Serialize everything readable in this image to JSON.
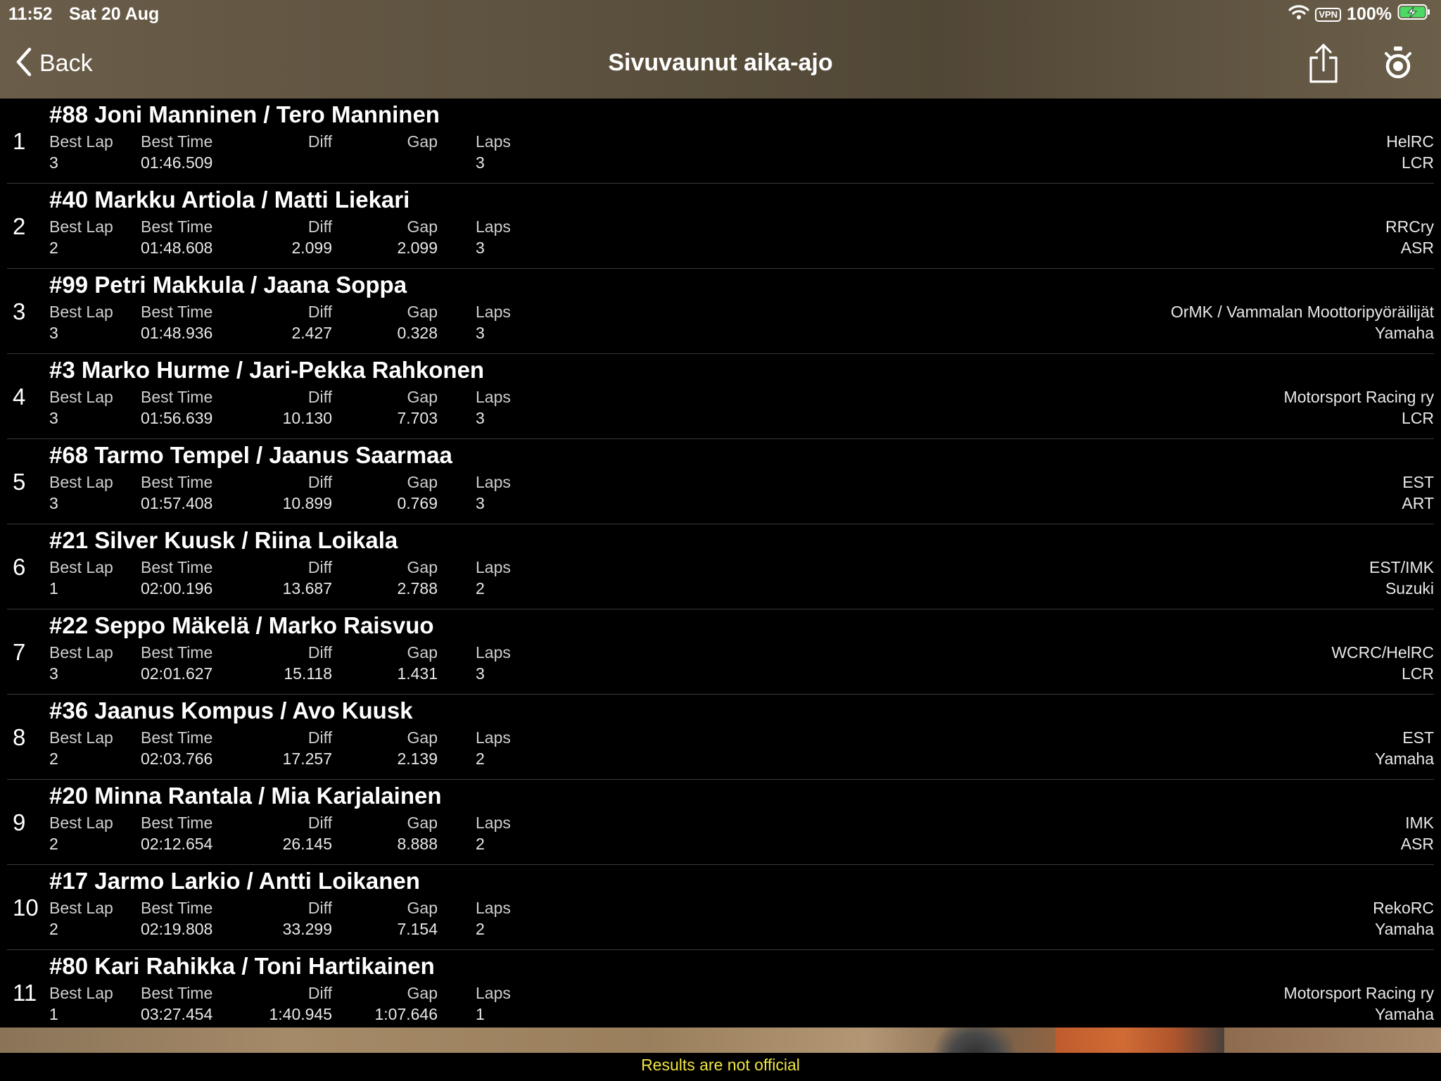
{
  "status_bar": {
    "time": "11:52",
    "date": "Sat 20 Aug",
    "vpn_label": "VPN",
    "battery": "100%"
  },
  "nav": {
    "back_label": "Back",
    "title": "Sivuvaunut aika-ajo"
  },
  "columns": {
    "best_lap": "Best Lap",
    "best_time": "Best Time",
    "diff": "Diff",
    "gap": "Gap",
    "laps": "Laps"
  },
  "results": [
    {
      "pos": "1",
      "driver": "#88 Joni Manninen / Tero Manninen",
      "best_lap": "3",
      "best_time": "01:46.509",
      "diff": "",
      "gap": "",
      "laps": "3",
      "club": "HelRC",
      "make": "LCR"
    },
    {
      "pos": "2",
      "driver": "#40 Markku Artiola / Matti Liekari",
      "best_lap": "2",
      "best_time": "01:48.608",
      "diff": "2.099",
      "gap": "2.099",
      "laps": "3",
      "club": "RRCry",
      "make": "ASR"
    },
    {
      "pos": "3",
      "driver": "#99 Petri Makkula / Jaana Soppa",
      "best_lap": "3",
      "best_time": "01:48.936",
      "diff": "2.427",
      "gap": "0.328",
      "laps": "3",
      "club": "OrMK / Vammalan Moottoripyöräilijät",
      "make": "Yamaha"
    },
    {
      "pos": "4",
      "driver": "#3 Marko Hurme / Jari-Pekka Rahkonen",
      "best_lap": "3",
      "best_time": "01:56.639",
      "diff": "10.130",
      "gap": "7.703",
      "laps": "3",
      "club": "Motorsport Racing ry",
      "make": "LCR"
    },
    {
      "pos": "5",
      "driver": "#68 Tarmo Tempel / Jaanus Saarmaa",
      "best_lap": "3",
      "best_time": "01:57.408",
      "diff": "10.899",
      "gap": "0.769",
      "laps": "3",
      "club": "EST",
      "make": "ART"
    },
    {
      "pos": "6",
      "driver": "#21 Silver Kuusk / Riina Loikala",
      "best_lap": "1",
      "best_time": "02:00.196",
      "diff": "13.687",
      "gap": "2.788",
      "laps": "2",
      "club": "EST/IMK",
      "make": "Suzuki"
    },
    {
      "pos": "7",
      "driver": "#22 Seppo Mäkelä / Marko Raisvuo",
      "best_lap": "3",
      "best_time": "02:01.627",
      "diff": "15.118",
      "gap": "1.431",
      "laps": "3",
      "club": "WCRC/HelRC",
      "make": "LCR"
    },
    {
      "pos": "8",
      "driver": "#36 Jaanus Kompus / Avo Kuusk",
      "best_lap": "2",
      "best_time": "02:03.766",
      "diff": "17.257",
      "gap": "2.139",
      "laps": "2",
      "club": "EST",
      "make": "Yamaha"
    },
    {
      "pos": "9",
      "driver": "#20 Minna Rantala / Mia Karjalainen",
      "best_lap": "2",
      "best_time": "02:12.654",
      "diff": "26.145",
      "gap": "8.888",
      "laps": "2",
      "club": "IMK",
      "make": "ASR"
    },
    {
      "pos": "10",
      "driver": "#17 Jarmo Larkio / Antti Loikanen",
      "best_lap": "2",
      "best_time": "02:19.808",
      "diff": "33.299",
      "gap": "7.154",
      "laps": "2",
      "club": "RekoRC",
      "make": "Yamaha"
    },
    {
      "pos": "11",
      "driver": "#80 Kari Rahikka / Toni Hartikainen",
      "best_lap": "1",
      "best_time": "03:27.454",
      "diff": "1:40.945",
      "gap": "1:07.646",
      "laps": "1",
      "club": "Motorsport Racing ry",
      "make": "Yamaha"
    }
  ],
  "footer": {
    "notice": "Results are not official",
    "notice_color": "#f0e640"
  },
  "icons": {
    "back": "chevron-left-icon",
    "share": "share-icon",
    "timer": "stopwatch-icon",
    "wifi": "wifi-icon",
    "battery": "battery-charging-icon"
  }
}
